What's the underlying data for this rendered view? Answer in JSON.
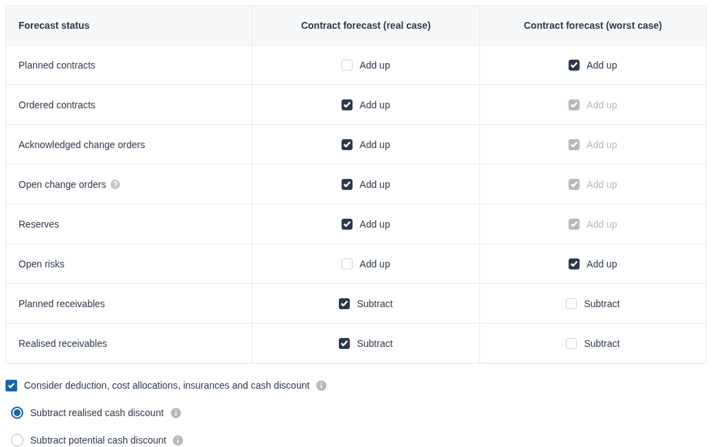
{
  "table": {
    "columns": [
      "Forecast status",
      "Contract forecast (real case)",
      "Contract forecast (worst case)"
    ],
    "rows": [
      {
        "cells": [
          {
            "label": "Planned contracts"
          },
          {
            "label": "Add up",
            "checked": false,
            "disabled": false
          },
          {
            "label": "Add up",
            "checked": true,
            "disabled": false
          }
        ]
      },
      {
        "cells": [
          {
            "label": "Ordered contracts"
          },
          {
            "label": "Add up",
            "checked": true,
            "disabled": false
          },
          {
            "label": "Add up",
            "checked": true,
            "disabled": true
          }
        ]
      },
      {
        "cells": [
          {
            "label": "Acknowledged change orders"
          },
          {
            "label": "Add up",
            "checked": true,
            "disabled": false
          },
          {
            "label": "Add up",
            "checked": true,
            "disabled": true
          }
        ]
      },
      {
        "cells": [
          {
            "label": "Open change orders",
            "help": true
          },
          {
            "label": "Add up",
            "checked": true,
            "disabled": false
          },
          {
            "label": "Add up",
            "checked": true,
            "disabled": true
          }
        ]
      },
      {
        "cells": [
          {
            "label": "Reserves"
          },
          {
            "label": "Add up",
            "checked": true,
            "disabled": false
          },
          {
            "label": "Add up",
            "checked": true,
            "disabled": true
          }
        ]
      },
      {
        "cells": [
          {
            "label": "Open risks"
          },
          {
            "label": "Add up",
            "checked": false,
            "disabled": false
          },
          {
            "label": "Add up",
            "checked": true,
            "disabled": false
          }
        ]
      },
      {
        "cells": [
          {
            "label": "Planned receivables"
          },
          {
            "label": "Subtract",
            "checked": true,
            "disabled": false
          },
          {
            "label": "Subtract",
            "checked": false,
            "disabled": false
          }
        ]
      },
      {
        "cells": [
          {
            "label": "Realised receivables"
          },
          {
            "label": "Subtract",
            "checked": true,
            "disabled": false
          },
          {
            "label": "Subtract",
            "checked": false,
            "disabled": false
          }
        ]
      }
    ]
  },
  "consider": {
    "label": "Consider deduction, cost allocations, insurances and cash discount",
    "checked": true
  },
  "options": [
    {
      "label": "Subtract realised cash discount",
      "selected": true
    },
    {
      "label": "Subtract potential cash discount",
      "selected": false
    }
  ]
}
